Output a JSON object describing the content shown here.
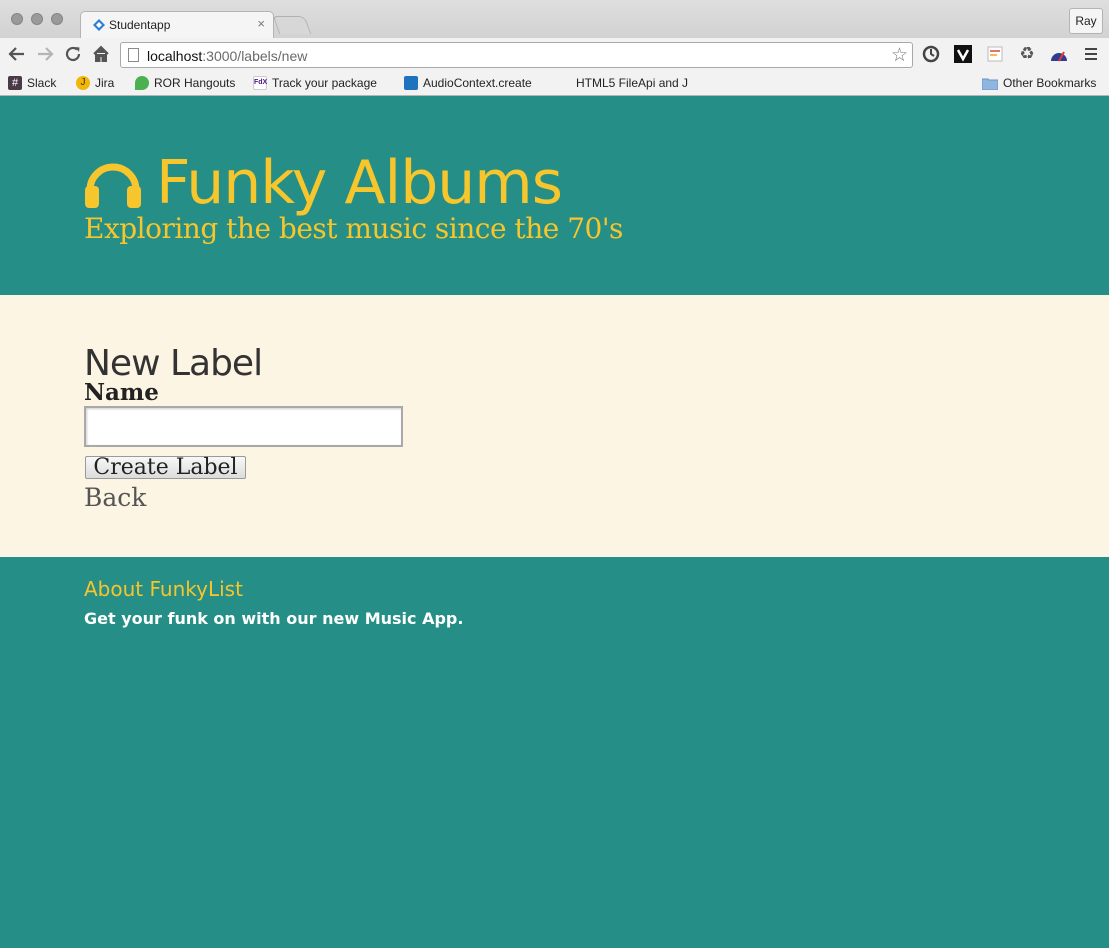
{
  "browser": {
    "tab_title": "Studentapp",
    "tab_close": "×",
    "profile_name": "Ray",
    "url_host": "localhost",
    "url_path": ":3000/labels/new",
    "bookmarks": [
      {
        "label": "Slack",
        "icon": "slack-icon"
      },
      {
        "label": "Jira",
        "icon": "jira-icon"
      },
      {
        "label": "ROR Hangouts",
        "icon": "hangouts-icon"
      },
      {
        "label": "Track your package",
        "icon": "fedex-icon"
      },
      {
        "label": "AudioContext.create",
        "icon": "docs-icon"
      },
      {
        "label": "HTML5 FileApi and J",
        "icon": "page-icon"
      }
    ],
    "other_bookmarks": "Other Bookmarks"
  },
  "header": {
    "site_name": "Funky Albums",
    "tagline": "Exploring the best music since the 70's",
    "icon": "headphones-icon",
    "accent_color": "#f7c52c",
    "background_color": "#258e86"
  },
  "form": {
    "page_title": "New Label",
    "name_label": "Name",
    "name_value": "",
    "submit_label": "Create Label",
    "back_label": "Back"
  },
  "footer": {
    "heading": "About FunkyList",
    "text": "Get your funk on with our new Music App."
  }
}
